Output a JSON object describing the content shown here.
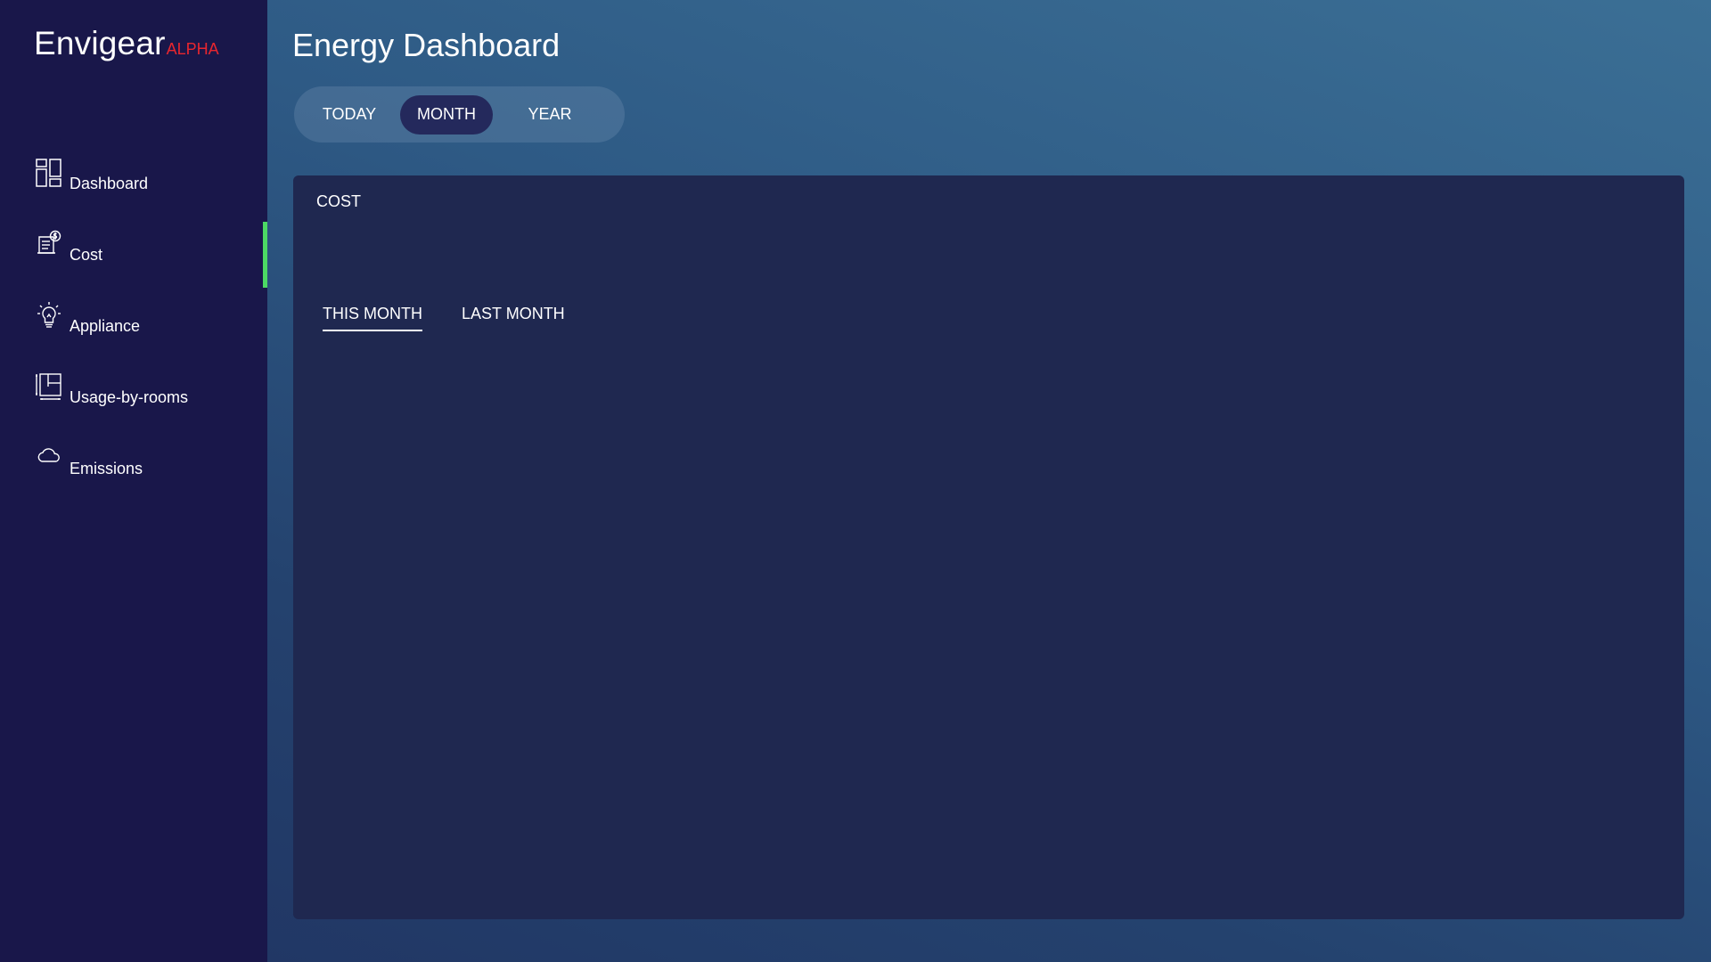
{
  "brand": {
    "name": "Envigear",
    "tag": "ALPHA",
    "tag_color": "#e8262e"
  },
  "sidebar": {
    "background": "#19174a",
    "active_indicator_color": "#4cd964",
    "items": [
      {
        "label": "Dashboard",
        "icon": "dashboard-grid-icon",
        "active": false
      },
      {
        "label": "Cost",
        "icon": "cost-receipt-icon",
        "active": true
      },
      {
        "label": "Appliance",
        "icon": "lightbulb-icon",
        "active": false
      },
      {
        "label": "Usage-by-rooms",
        "icon": "room-layout-icon",
        "active": false
      },
      {
        "label": "Emissions",
        "icon": "cloud-icon",
        "active": false
      }
    ]
  },
  "main": {
    "title": "Energy Dashboard",
    "range_tabs": [
      {
        "label": "TODAY",
        "selected": false
      },
      {
        "label": "MONTH",
        "selected": true
      },
      {
        "label": "YEAR",
        "selected": false
      }
    ],
    "cost_card": {
      "title": "COST",
      "period_tabs": [
        {
          "label": "THIS MONTH",
          "selected": true
        },
        {
          "label": "LAST MONTH",
          "selected": false
        }
      ]
    }
  }
}
